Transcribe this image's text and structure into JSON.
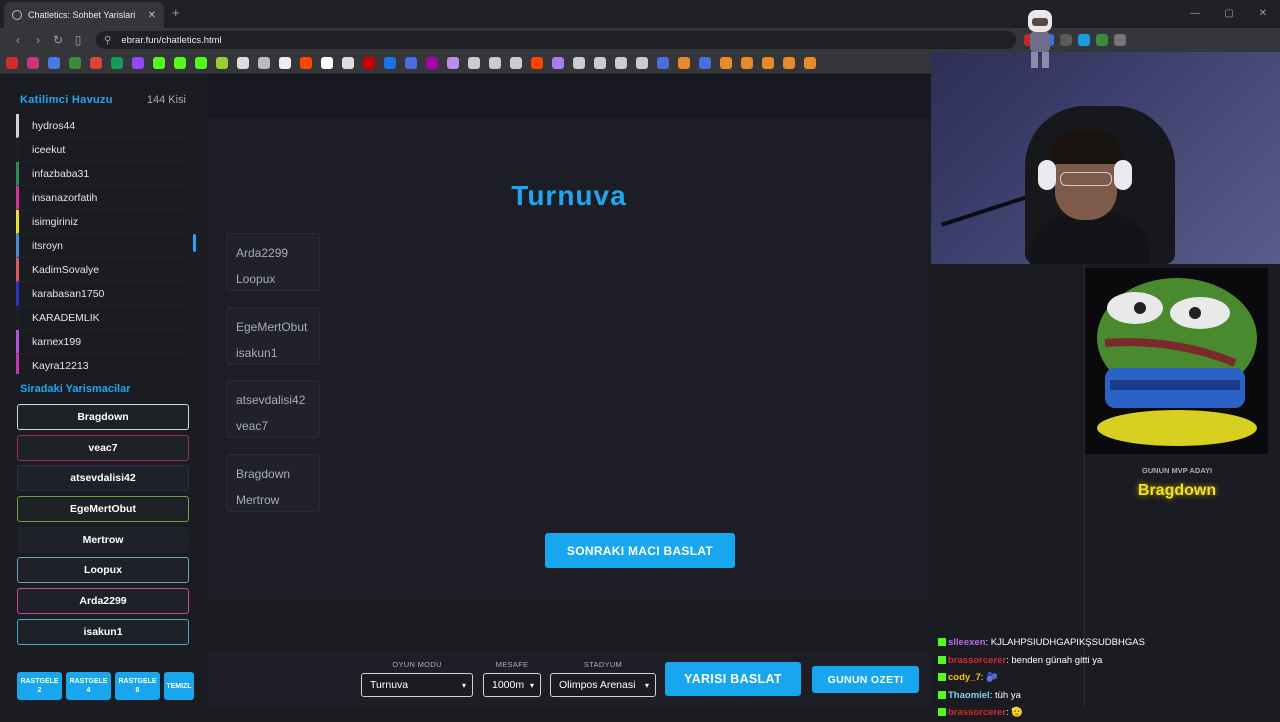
{
  "browser": {
    "tab_title": "Chatletics: Sohbet Yarislari",
    "url": "ebrar.fun/chatletics.html"
  },
  "colors": {
    "accent": "#1ea7f0",
    "mvp": "#f7e11e",
    "panel": "#1b1c22"
  },
  "pool": {
    "title": "Katilimci Havuzu",
    "count": "144 Kisi",
    "items": [
      {
        "name": "hydros44",
        "color": "#cfd2d8"
      },
      {
        "name": "iceekut",
        "color": "#1e2026"
      },
      {
        "name": "infazbaba31",
        "color": "#2a8a5a"
      },
      {
        "name": "insanazorfatih",
        "color": "#d4349a"
      },
      {
        "name": "isimgiriniz",
        "color": "#e4e130"
      },
      {
        "name": "itsroyn",
        "color": "#4a8ad6"
      },
      {
        "name": "KadimSovalye",
        "color": "#d35c68"
      },
      {
        "name": "karabasan1750",
        "color": "#2b35c8"
      },
      {
        "name": "KARADEMLIK",
        "color": "#1e2026"
      },
      {
        "name": "karnex199",
        "color": "#a75ad8"
      },
      {
        "name": "Kayra12213",
        "color": "#c03aa8"
      }
    ]
  },
  "queue": {
    "title": "Siradaki Yarismacilar",
    "items": [
      {
        "name": "Bragdown",
        "color": "#d8d8d8"
      },
      {
        "name": "veac7",
        "color": "#9c2a52"
      },
      {
        "name": "atsevdalisi42",
        "color": "#2a2f4f"
      },
      {
        "name": "EgeMertObut",
        "color": "#6aa43a"
      },
      {
        "name": "Mertrow",
        "color": "#1f2128"
      },
      {
        "name": "Loopux",
        "color": "#6ea0b9"
      },
      {
        "name": "Arda2299",
        "color": "#c94a9c"
      },
      {
        "name": "isakun1",
        "color": "#41a9c6"
      }
    ],
    "random_buttons": [
      {
        "line1": "RASTGELE",
        "line2": "2"
      },
      {
        "line1": "RASTGELE",
        "line2": "4"
      },
      {
        "line1": "RASTGELE",
        "line2": "8"
      },
      {
        "line1": "TEMIZL",
        "line2": ""
      }
    ]
  },
  "main": {
    "title": "Turnuva",
    "matches": [
      {
        "a": "Arda2299",
        "b": "Loopux"
      },
      {
        "a": "EgeMertObut",
        "b": "isakun1"
      },
      {
        "a": "atsevdalisi42",
        "b": "veac7"
      },
      {
        "a": "Bragdown",
        "b": "Mertrow"
      }
    ],
    "next_match_label": "SONRAKI MACI BASLAT"
  },
  "controls": {
    "mode_label": "OYUN MODU",
    "mode_value": "Turnuva",
    "distance_label": "MESAFE",
    "distance_value": "1000m",
    "stadium_label": "STADYUM",
    "stadium_value": "Olimpos Arenasi",
    "start_label": "YARISI BASLAT",
    "summary_label": "GUNUN OZETI"
  },
  "mvp": {
    "label": "GUNUN MVP ADAYI",
    "name": "Bragdown"
  },
  "chat": [
    {
      "user": "slleexen",
      "user_color": "#b26cf0",
      "text": ": KJLAHPSIUDHGAPIKŞSUDBHGAS"
    },
    {
      "user": "brassorcerer",
      "user_color": "#d42a2a",
      "text": ": benden günah gitti ya"
    },
    {
      "user": "cody_7",
      "user_color": "#f3c21e",
      "text": ": 🫐"
    },
    {
      "user": "Thaomiel",
      "user_color": "#7fd0f0",
      "text": ": tüh ya"
    },
    {
      "user": "brassorcerer",
      "user_color": "#d42a2a",
      "text": ": 🫡"
    }
  ]
}
